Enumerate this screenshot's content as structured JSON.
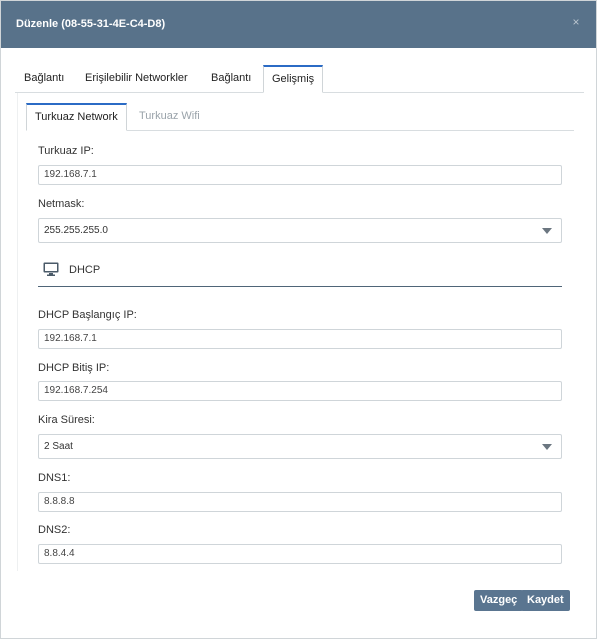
{
  "dialog": {
    "title": "Düzenle (08-55-31-4E-C4-D8)",
    "close_glyph": "×"
  },
  "top_tabs": [
    {
      "label": "Bağlantı"
    },
    {
      "label": "Erişilebilir Networkler"
    },
    {
      "label": "Bağlantı"
    },
    {
      "label": "Gelişmiş",
      "active": true
    }
  ],
  "sub_tabs": [
    {
      "label": "Turkuaz Network",
      "active": true
    },
    {
      "label": "Turkuaz Wifi"
    }
  ],
  "form": {
    "turkuaz_ip": {
      "label": "Turkuaz IP:",
      "value": "192.168.7.1"
    },
    "netmask": {
      "label": "Netmask:",
      "value": "255.255.255.0"
    },
    "dhcp_section": {
      "title": "DHCP",
      "icon": "monitor-icon"
    },
    "dhcp_start": {
      "label": "DHCP Başlangıç IP:",
      "value": "192.168.7.1"
    },
    "dhcp_end": {
      "label": "DHCP Bitiş IP:",
      "value": "192.168.7.254"
    },
    "lease": {
      "label": "Kira Süresi:",
      "value": "2 Saat"
    },
    "dns1": {
      "label": "DNS1:",
      "value": "8.8.8.8"
    },
    "dns2": {
      "label": "DNS2:",
      "value": "8.8.4.4"
    }
  },
  "buttons": {
    "cancel": "Vazgeç",
    "save": "Kaydet"
  },
  "colors": {
    "header_bg": "#58728a",
    "button_bg": "#5a7590",
    "active_tab_accent": "#2b6bc5"
  }
}
